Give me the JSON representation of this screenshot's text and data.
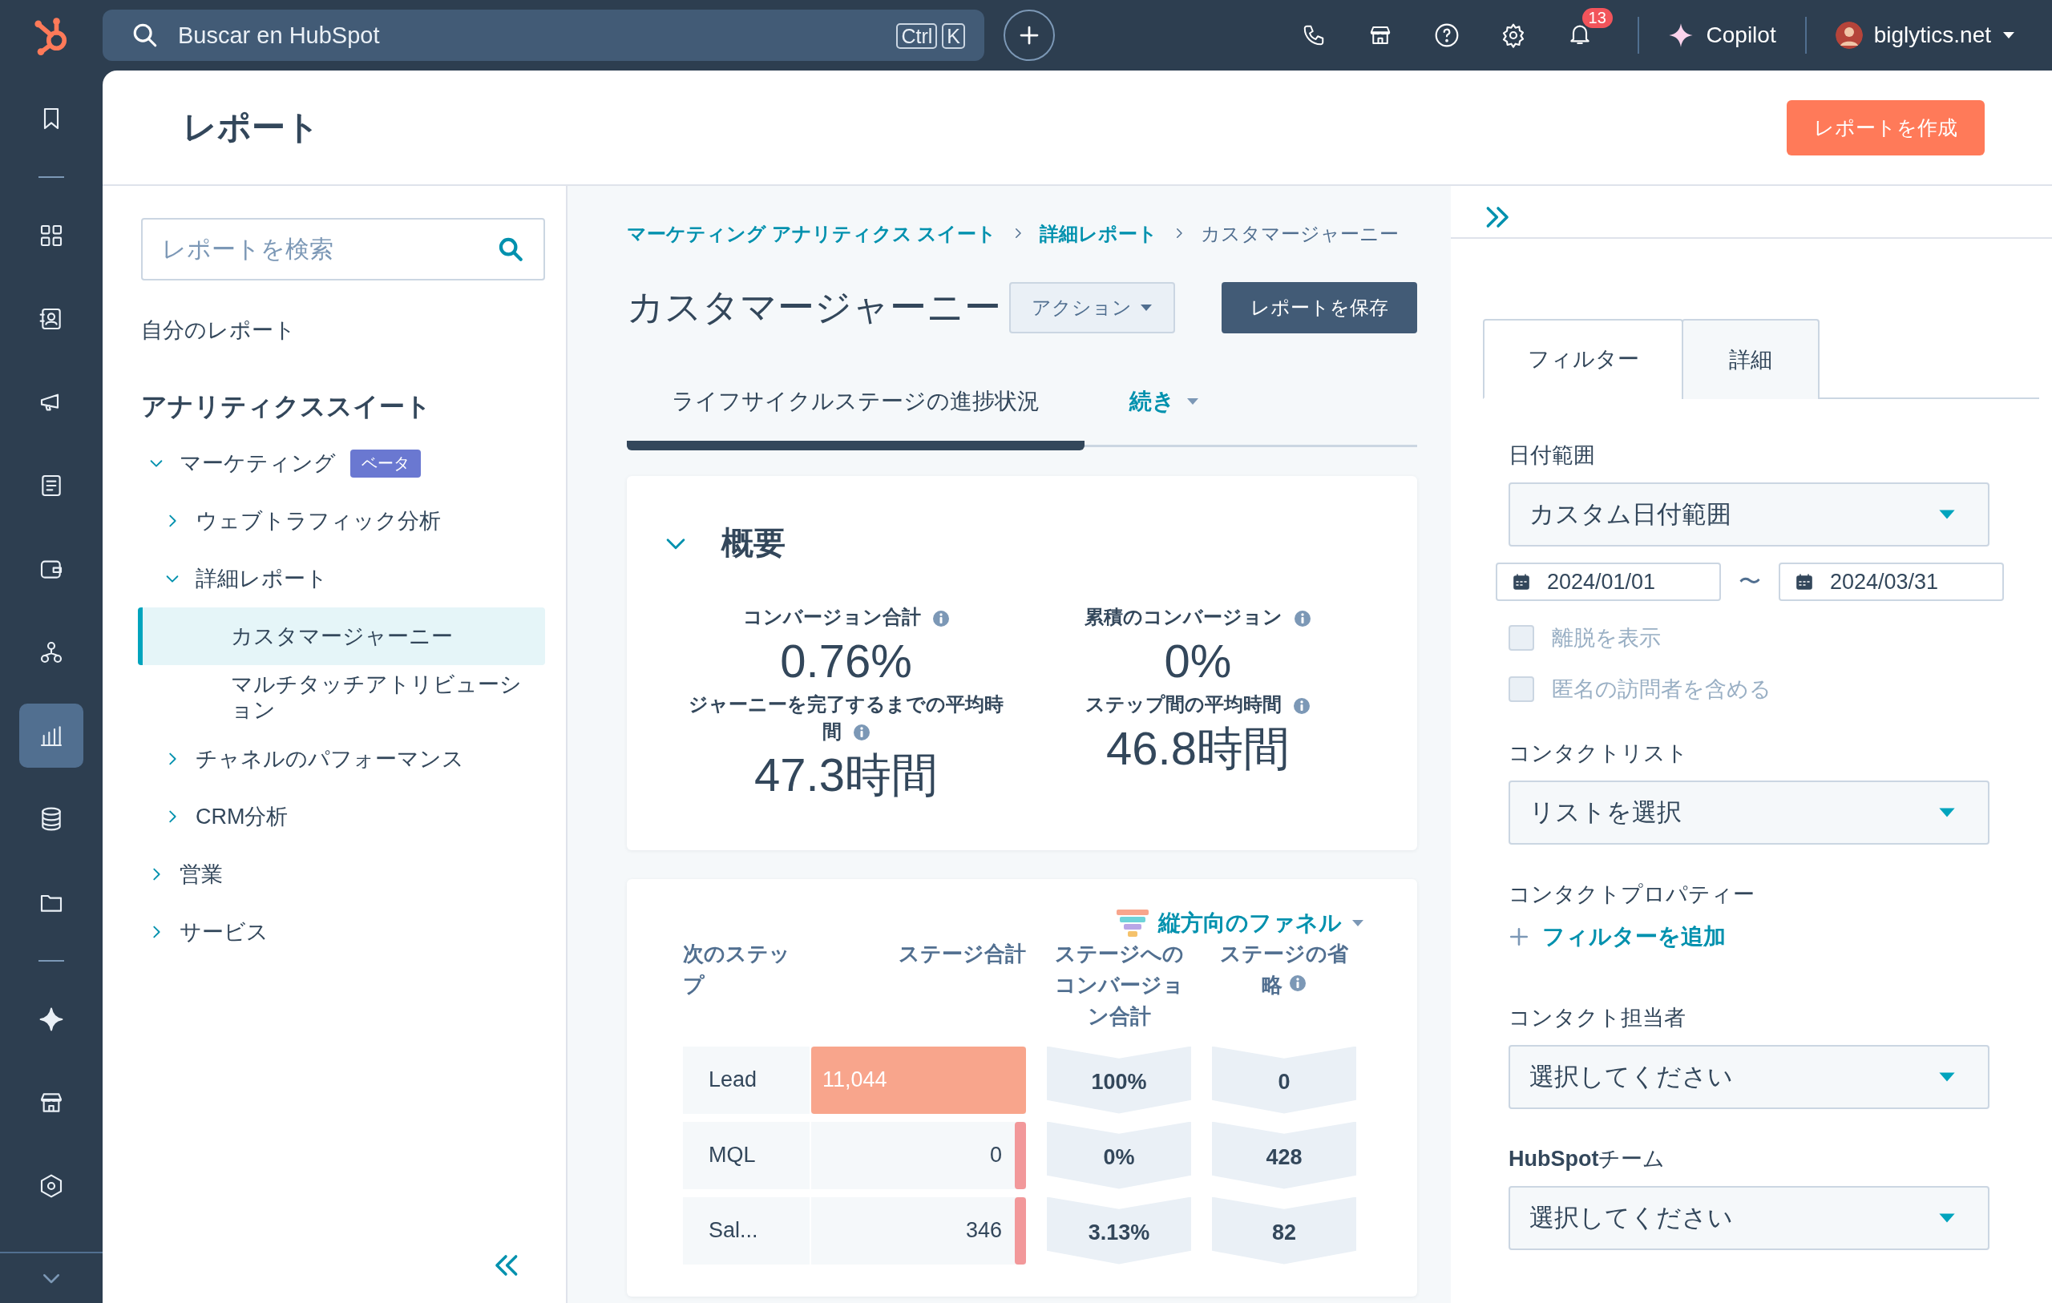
{
  "top_bar": {
    "search": {
      "placeholder": "Buscar en HubSpot",
      "shortcut": [
        "Ctrl",
        "K"
      ]
    },
    "notifications_count": "13",
    "copilot": "Copilot",
    "account": "biglytics.net"
  },
  "nav_rail": [
    {
      "kind": "icon",
      "selected": false
    },
    {
      "kind": "divider"
    },
    {
      "kind": "icon",
      "selected": false
    },
    {
      "kind": "icon",
      "selected": false
    },
    {
      "kind": "icon",
      "selected": false
    },
    {
      "kind": "icon",
      "selected": false
    },
    {
      "kind": "icon",
      "selected": false
    },
    {
      "kind": "icon",
      "selected": false
    },
    {
      "kind": "icon",
      "selected": true
    },
    {
      "kind": "icon",
      "selected": false
    },
    {
      "kind": "icon",
      "selected": false
    },
    {
      "kind": "divider"
    },
    {
      "kind": "icon",
      "selected": false
    },
    {
      "kind": "icon",
      "selected": false
    },
    {
      "kind": "icon",
      "selected": false
    }
  ],
  "page": {
    "title": "レポート",
    "create_button": "レポートを作成"
  },
  "sidebar": {
    "search": {
      "placeholder": "レポートを検索"
    },
    "my_reports": "自分のレポート",
    "section": "アナリティクススイート",
    "tree": [
      {
        "label": "マーケティング",
        "kind": "folder",
        "expanded": true,
        "selected": false,
        "badge": "ベータ",
        "children": [
          {
            "label": "ウェブトラフィック分析",
            "kind": "folder",
            "expanded": false,
            "selected": false
          },
          {
            "label": "詳細レポート",
            "kind": "folder",
            "expanded": true,
            "selected": false,
            "children": [
              {
                "label": "カスタマージャーニー",
                "kind": "report",
                "selected": true
              },
              {
                "label": "マルチタッチアトリビューション",
                "kind": "report",
                "selected": false
              }
            ]
          },
          {
            "label": "チャネルのパフォーマンス",
            "kind": "folder",
            "expanded": false,
            "selected": false
          },
          {
            "label": "CRM分析",
            "kind": "folder",
            "expanded": false,
            "selected": false
          }
        ]
      },
      {
        "label": "営業",
        "kind": "folder",
        "expanded": false,
        "selected": false
      },
      {
        "label": "サービス",
        "kind": "folder",
        "expanded": false,
        "selected": false
      }
    ]
  },
  "report": {
    "breadcrumbs": [
      {
        "label": "マーケティング アナリティクス スイート",
        "kind": "link"
      },
      {
        "label": "詳細レポート",
        "kind": "link"
      },
      {
        "label": "カスタマージャーニー",
        "kind": "current"
      }
    ],
    "title": "カスタマージャーニー",
    "actions_button": "アクション",
    "save_button": "レポートを保存",
    "tabs": [
      {
        "label": "ライフサイクルステージの進捗状況",
        "kind": "tab",
        "selected": true
      },
      {
        "label": "続き",
        "kind": "more",
        "selected": false
      }
    ],
    "summary": {
      "title": "概要",
      "expanded": true,
      "metrics": [
        {
          "label": "コンバージョン合計",
          "value": "0.76%"
        },
        {
          "label": "累積のコンバージョン",
          "value": "0%"
        },
        {
          "label": "ジャーニーを完了するまでの平均時間",
          "value": "47.3時間"
        },
        {
          "label": "ステップ間の平均時間",
          "value": "46.8時間"
        }
      ]
    },
    "funnel": {
      "view_selector": "縦方向のファネル",
      "columns": [
        "次のステップ",
        "ステージ合計",
        "ステージへのコンバージョン合計",
        "ステージの省略"
      ],
      "rows": [
        {
          "stage": "Lead",
          "total": "11,044",
          "level": 1,
          "conversion": "100%",
          "dropoff": "0"
        },
        {
          "stage": "MQL",
          "total": "0",
          "level": 0,
          "conversion": "0%",
          "dropoff": "428"
        },
        {
          "stage": "Sal...",
          "total": "346",
          "level": 0.031,
          "conversion": "3.13%",
          "dropoff": "82"
        }
      ]
    }
  },
  "filters": {
    "tabs": [
      {
        "label": "フィルター",
        "selected": true
      },
      {
        "label": "詳細",
        "selected": false
      }
    ],
    "date_range": {
      "label": "日付範囲",
      "value": "カスタム日付範囲",
      "start": "2024/01/01",
      "separator": "〜",
      "end": "2024/03/31"
    },
    "checkboxes": [
      {
        "label": "離脱を表示",
        "checked": false,
        "disabled": true
      },
      {
        "label": "匿名の訪問者を含める",
        "checked": false,
        "disabled": true
      }
    ],
    "contact_list": {
      "label": "コンタクトリスト",
      "value": "リストを選択"
    },
    "contact_property": {
      "label": "コンタクトプロパティー",
      "add_filter": "フィルターを追加"
    },
    "contact_owner": {
      "label": "コンタクト担当者",
      "value": "選択してください"
    },
    "team": {
      "label": "**HubSpot**チーム",
      "value": "選択してください"
    }
  }
}
